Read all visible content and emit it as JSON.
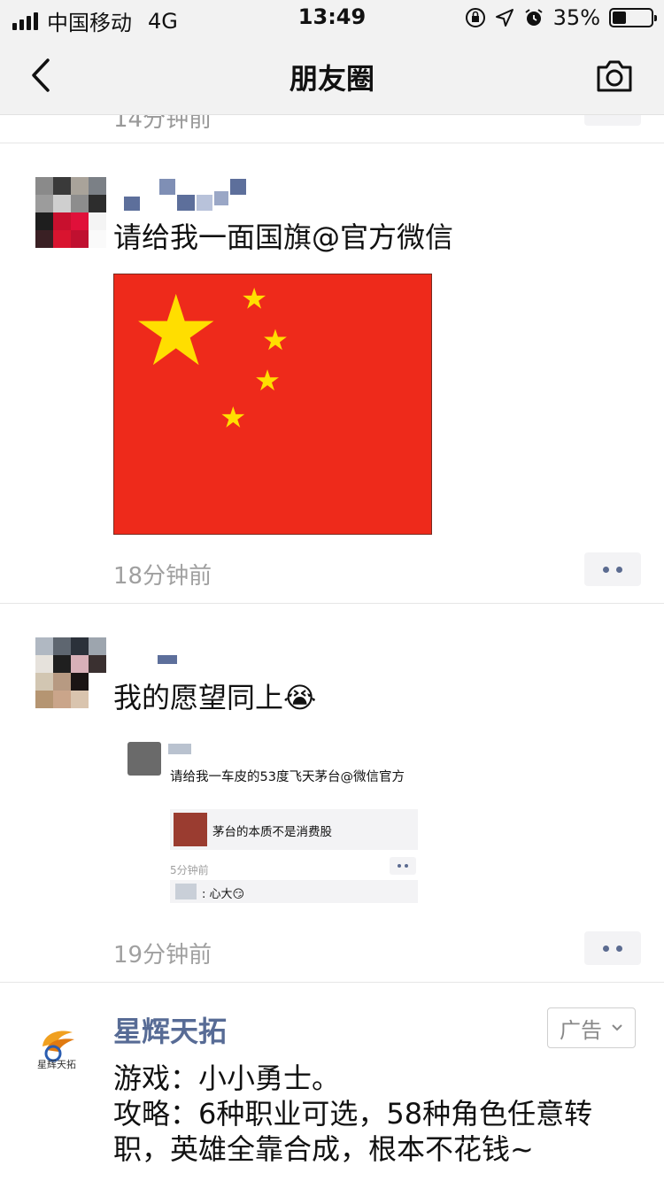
{
  "status_bar": {
    "carrier": "中国移动",
    "network": "4G",
    "time": "13:49",
    "battery": "35%",
    "battery_level": 0.35
  },
  "nav": {
    "title": "朋友圈",
    "back_icon": "chevron-left-icon",
    "camera_icon": "camera-icon"
  },
  "remnant": {
    "time": "14分钟前"
  },
  "posts": [
    {
      "text": "请给我一面国旗@官方微信",
      "time": "18分钟前"
    },
    {
      "text": "我的愿望同上",
      "emoji": "😭",
      "time": "19分钟前",
      "embedded": {
        "text": "请给我一车皮的53度飞天茅台@微信官方",
        "link_title": "茅台的本质不是消费股",
        "time": "5分钟前",
        "comment": ": 心大",
        "comment_emoji": "😏"
      }
    }
  ],
  "ad": {
    "logo_text": "星辉天拓",
    "name": "星辉天拓",
    "badge": "广告",
    "line1": "游戏：小小勇士。",
    "line2": "攻略：6种职业可选，58种角色任意转职，英雄全靠合成，根本不花钱~"
  },
  "colors": {
    "link_blue": "#576b95",
    "flag_red": "#ee2a1b",
    "star_yellow": "#ffde00"
  }
}
